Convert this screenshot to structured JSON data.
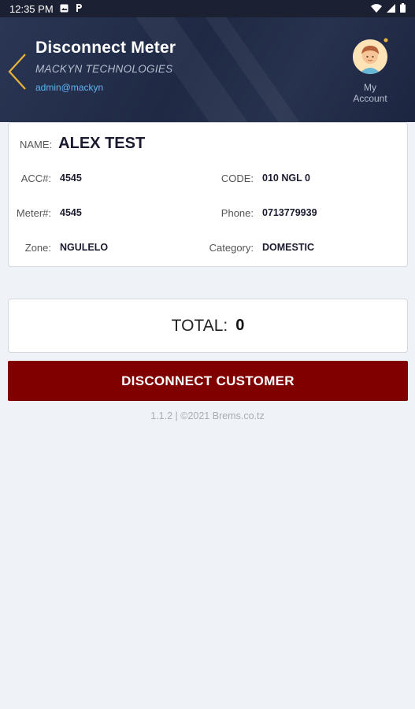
{
  "status_bar": {
    "time": "12:35 PM",
    "icons": [
      "image-icon",
      "parking-icon",
      "wifi-icon",
      "signal-icon",
      "battery-icon"
    ]
  },
  "header": {
    "title": "Disconnect Meter",
    "company": "MACKYN TECHNOLOGIES",
    "user": "admin@mackyn",
    "account_label": "My Account",
    "accent_color": "#e8b53a"
  },
  "customer": {
    "name_label": "NAME:",
    "name_value": "ALEX TEST",
    "fields": [
      {
        "label": "ACC#:",
        "value": "4545"
      },
      {
        "label": "CODE:",
        "value": "010 NGL 0"
      },
      {
        "label": "Meter#:",
        "value": "4545"
      },
      {
        "label": "Phone:",
        "value": "0713779939"
      },
      {
        "label": "Zone:",
        "value": "NGULELO"
      },
      {
        "label": "Category:",
        "value": "DOMESTIC"
      }
    ]
  },
  "total": {
    "label": "TOTAL:",
    "value": "0"
  },
  "action": {
    "disconnect_label": "DISCONNECT CUSTOMER",
    "color": "#800000"
  },
  "footer": {
    "text": "1.1.2 | ©2021 Brems.co.tz"
  }
}
